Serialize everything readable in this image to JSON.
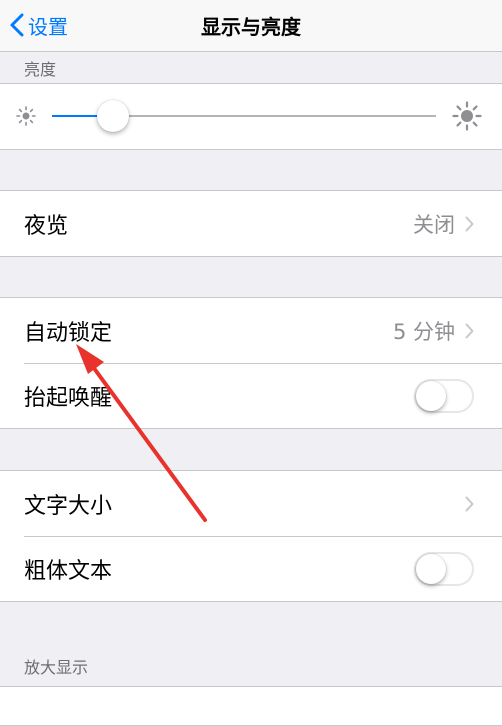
{
  "nav": {
    "back_label": "设置",
    "title": "显示与亮度"
  },
  "brightness": {
    "header": "亮度",
    "level": 0.16,
    "accent": "#007aff"
  },
  "night_shift": {
    "label": "夜览",
    "value": "关闭"
  },
  "auto_lock": {
    "label": "自动锁定",
    "value": "5 分钟"
  },
  "raise_to_wake": {
    "label": "抬起唤醒",
    "on": false
  },
  "text_size": {
    "label": "文字大小"
  },
  "bold_text": {
    "label": "粗体文本",
    "on": false
  },
  "zoom": {
    "header": "放大显示"
  },
  "icons": [
    "chevron-left-icon",
    "sun-small-icon",
    "sun-large-icon",
    "chevron-right-icon",
    "annotation-arrow"
  ],
  "annotation_color": "#e8322b"
}
